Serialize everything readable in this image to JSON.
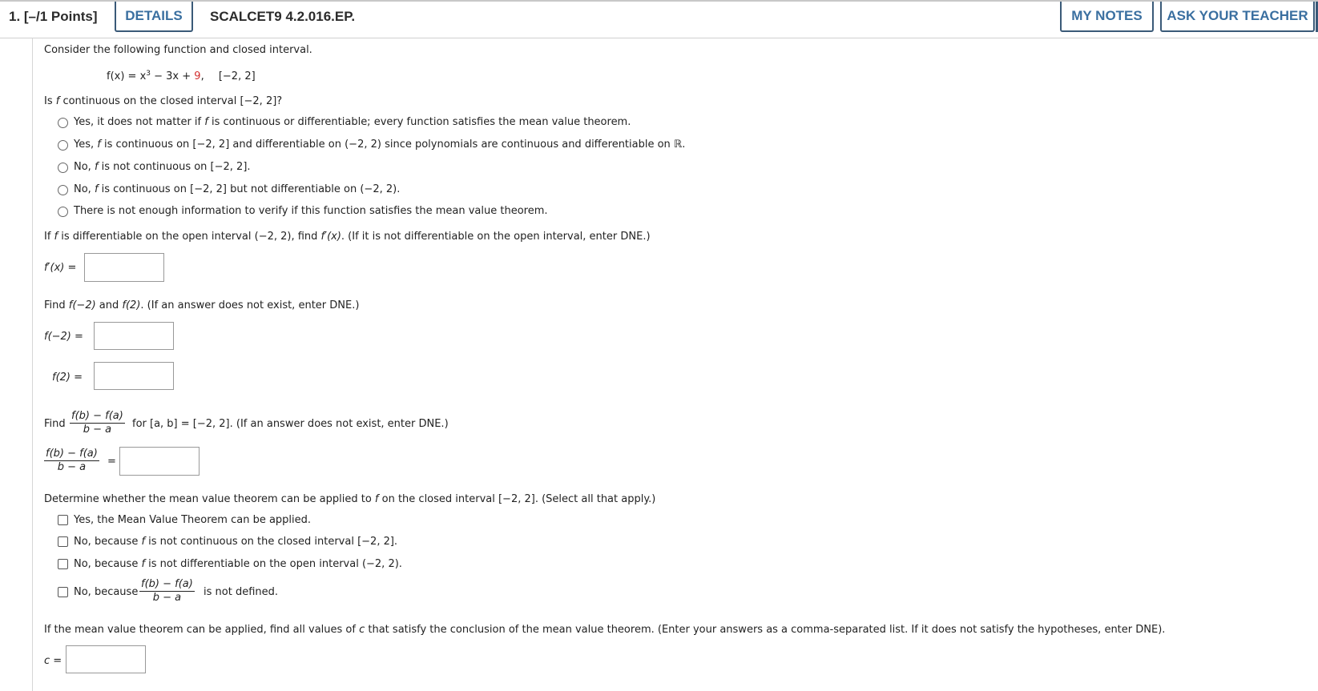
{
  "header": {
    "points": "1.  [–/1 Points]",
    "details_label": "DETAILS",
    "problem_code": "SCALCET9 4.2.016.EP.",
    "my_notes_label": "MY NOTES",
    "ask_teacher_label": "ASK YOUR TEACHER"
  },
  "intro": "Consider the following function and closed interval.",
  "function": {
    "lhs": "f(x) = x",
    "exp": "3",
    "mid": " − 3x + ",
    "const": "9",
    "tail": ",",
    "interval": "[−2, 2]"
  },
  "q1": {
    "pre": "Is ",
    "f": "f",
    "post": " continuous on the closed interval [−2, 2]?",
    "options": [
      {
        "a": "Yes, it does not matter if ",
        "f": "f",
        "b": " is continuous or differentiable; every function satisfies the mean value theorem."
      },
      {
        "a": "Yes, ",
        "f": "f",
        "b": " is continuous on [−2, 2] and differentiable on (−2, 2) since polynomials are continuous and differentiable on ℝ."
      },
      {
        "a": "No, ",
        "f": "f",
        "b": " is not continuous on [−2, 2]."
      },
      {
        "a": "No, ",
        "f": "f",
        "b": " is continuous on [−2, 2] but not differentiable on (−2, 2)."
      },
      {
        "a": "There is not enough information to verify if this function satisfies the mean value theorem.",
        "f": "",
        "b": ""
      }
    ]
  },
  "q2": {
    "pre": "If ",
    "f": "f",
    "mid": " is differentiable on the open interval (−2, 2), find ",
    "fprime": "f′(x)",
    "post": ". (If it is not differentiable on the open interval, enter DNE.)",
    "label": "f′(x) =",
    "value": ""
  },
  "q3": {
    "text_a": "Find ",
    "f1": "f(−2)",
    "text_b": " and ",
    "f2": "f(2)",
    "text_c": ". (If an answer does not exist, enter DNE.)",
    "label_neg": "f(−2) =",
    "label_pos": "f(2) =",
    "value_neg": "",
    "value_pos": ""
  },
  "q4": {
    "find": "Find",
    "num": "f(b) − f(a)",
    "den": "b − a",
    "post": "for [a, b] = [−2, 2]. (If an answer does not exist, enter DNE.)",
    "eq": "=",
    "value": ""
  },
  "q5": {
    "pre": "Determine whether the mean value theorem can be applied to ",
    "f": "f",
    "post": " on the closed interval [−2, 2]. (Select all that apply.)",
    "opt1": "Yes, the Mean Value Theorem can be applied.",
    "opt2a": "No, because ",
    "opt2f": "f",
    "opt2b": " is not continuous on the closed interval [−2, 2].",
    "opt3a": "No, because ",
    "opt3f": "f",
    "opt3b": " is not differentiable on the open interval (−2, 2).",
    "opt4a": "No, because",
    "opt4num": "f(b) − f(a)",
    "opt4den": "b − a",
    "opt4b": "is not defined."
  },
  "q6": {
    "pre": "If the mean value theorem can be applied, find all values of ",
    "c": "c",
    "post": " that satisfy the conclusion of the mean value theorem. (Enter your answers as a comma-separated list. If it does not satisfy the hypotheses, enter DNE).",
    "label": "c =",
    "value": ""
  }
}
